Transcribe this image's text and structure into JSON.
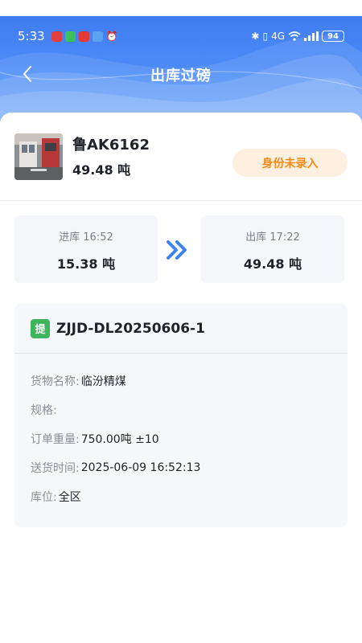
{
  "status_bar": {
    "time": "5:33",
    "network_label": "4G",
    "battery_level": "94",
    "app_icon_colors": [
      "#e24040",
      "#3cc15c",
      "#e53935",
      "#5aa3f0"
    ]
  },
  "nav": {
    "title": "出库过磅",
    "back_icon": "chevron-left-icon"
  },
  "vehicle": {
    "plate": "鲁AK6162",
    "weight": "49.48 吨",
    "id_status": "身份未录入"
  },
  "weighing": {
    "in": {
      "label": "进库",
      "time": "16:52",
      "weight": "15.38 吨"
    },
    "out": {
      "label": "出库",
      "time": "17:22",
      "weight": "49.48 吨"
    },
    "arrow_icon": "double-chevron-right-icon"
  },
  "order": {
    "tag": "提",
    "tag_color": "#3cb55c",
    "number": "ZJJD-DL20250606-1",
    "fields": [
      {
        "label": "货物名称:",
        "value": "临汾精煤"
      },
      {
        "label": "规格:",
        "value": ""
      },
      {
        "label": "订单重量:",
        "value": "750.00吨 ±10"
      },
      {
        "label": "送货时间:",
        "value": "2025-06-09 16:52:13"
      },
      {
        "label": "库位:",
        "value": "全区"
      }
    ]
  },
  "colors": {
    "header_blue": "#4c8bf6",
    "badge_orange": "#f08a1a",
    "badge_bg": "#fdf0e0",
    "arrow_blue": "#3d82f5"
  }
}
